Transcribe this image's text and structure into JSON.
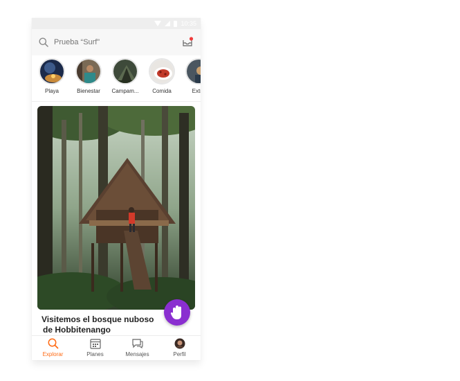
{
  "status_bar": {
    "time": "10:35"
  },
  "search": {
    "placeholder": "Prueba “Surf”",
    "icon": "search-icon"
  },
  "inbox": {
    "icon": "inbox-icon",
    "has_notification": true
  },
  "stories": [
    {
      "label": "Playa"
    },
    {
      "label": "Bienestar"
    },
    {
      "label": "Campam..."
    },
    {
      "label": "Comida"
    },
    {
      "label": "Extre"
    }
  ],
  "card": {
    "title_line1": "Visitemos el bosque nuboso",
    "title_line2": "de Hobbitenango"
  },
  "fab": {
    "icon": "hand-icon"
  },
  "bottom_nav": {
    "active": "Explorar",
    "items": [
      {
        "label": "Explorar",
        "icon": "search-icon"
      },
      {
        "label": "Planes",
        "icon": "calendar-icon"
      },
      {
        "label": "Mensajes",
        "icon": "chat-icon"
      },
      {
        "label": "Perfil",
        "icon": "avatar"
      }
    ]
  },
  "colors": {
    "accent": "#ff6a13",
    "fab": "#8a2fd0",
    "notification": "#f03c3c"
  }
}
